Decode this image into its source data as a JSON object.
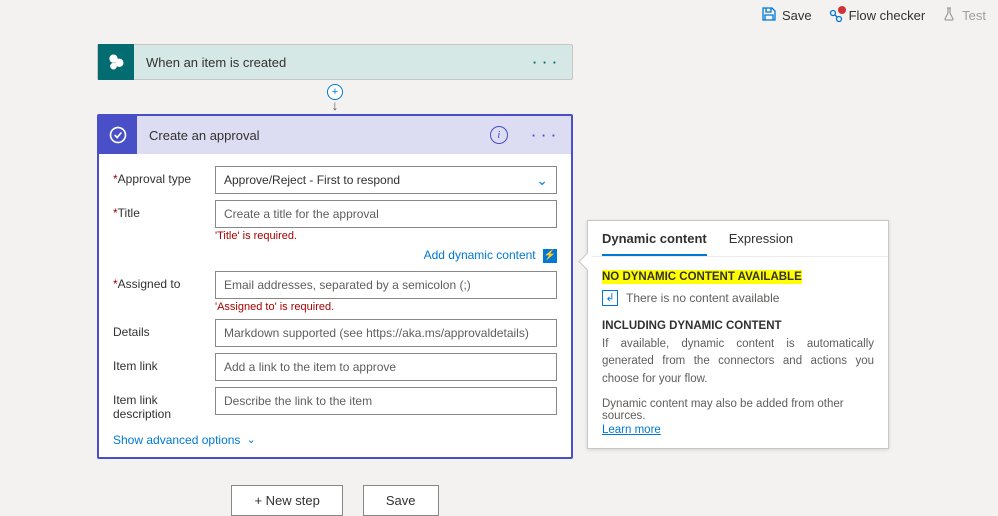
{
  "toolbar": {
    "save": "Save",
    "flow_checker": "Flow checker",
    "test": "Test"
  },
  "trigger": {
    "title": "When an item is created"
  },
  "action": {
    "title": "Create an approval",
    "fields": {
      "approval_type": {
        "label": "Approval type",
        "value": "Approve/Reject - First to respond"
      },
      "title": {
        "label": "Title",
        "placeholder": "Create a title for the approval",
        "error": "'Title' is required."
      },
      "assigned_to": {
        "label": "Assigned to",
        "placeholder": "Email addresses, separated by a semicolon (;)",
        "error": "'Assigned to' is required."
      },
      "details": {
        "label": "Details",
        "placeholder": "Markdown supported (see https://aka.ms/approvaldetails)"
      },
      "item_link": {
        "label": "Item link",
        "placeholder": "Add a link to the item to approve"
      },
      "item_link_desc": {
        "label": "Item link description",
        "placeholder": "Describe the link to the item"
      }
    },
    "add_dynamic": "Add dynamic content",
    "advanced": "Show advanced options"
  },
  "footer": {
    "new_step": "+ New step",
    "save": "Save"
  },
  "flyout": {
    "tab_dynamic": "Dynamic content",
    "tab_expression": "Expression",
    "no_content_title": "NO DYNAMIC CONTENT AVAILABLE",
    "no_content_msg": "There is no content available",
    "including_title": "INCLUDING DYNAMIC CONTENT",
    "including_msg": "If available, dynamic content is automatically generated from the connectors and actions you choose for your flow.",
    "other_msg": "Dynamic content may also be added from other sources.",
    "learn": "Learn more"
  }
}
